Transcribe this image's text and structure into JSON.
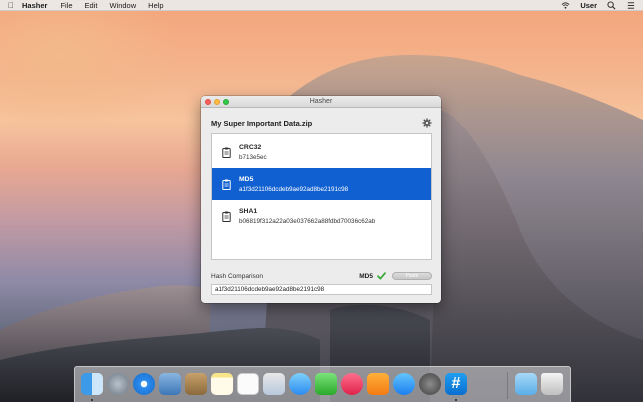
{
  "menubar": {
    "app_name": "Hasher",
    "menus": [
      "File",
      "Edit",
      "Window",
      "Help"
    ],
    "user": "User"
  },
  "window": {
    "title": "Hasher",
    "file_name": "My Super Important Data.zip",
    "hashes": [
      {
        "algorithm": "CRC32",
        "value": "b713e5ec",
        "selected": false
      },
      {
        "algorithm": "MD5",
        "value": "a1f3d21106dcdeb9ae92ad8be2191c98",
        "selected": true
      },
      {
        "algorithm": "SHA1",
        "value": "b06819f312a22a03e037662a88fdbd70036c62ab",
        "selected": false
      }
    ],
    "comparison": {
      "label": "Hash Comparison",
      "algorithm": "MD5",
      "paste_label": "Paste",
      "input_value": "a1f3d21106dcdeb9ae92ad8be2191c98"
    }
  },
  "dock": {
    "apps": [
      "finder-icon",
      "launchpad-icon",
      "safari-icon",
      "mail-icon",
      "contacts-icon",
      "notes-icon",
      "reminders-icon",
      "preview-icon",
      "messages-icon",
      "facetime-icon",
      "itunes-icon",
      "ibooks-icon",
      "app-store-icon",
      "system-preferences-icon",
      "hasher-icon",
      "downloads-icon",
      "trash-icon"
    ]
  },
  "colors": {
    "selection": "#1160d2",
    "check": "#3aa83a"
  }
}
